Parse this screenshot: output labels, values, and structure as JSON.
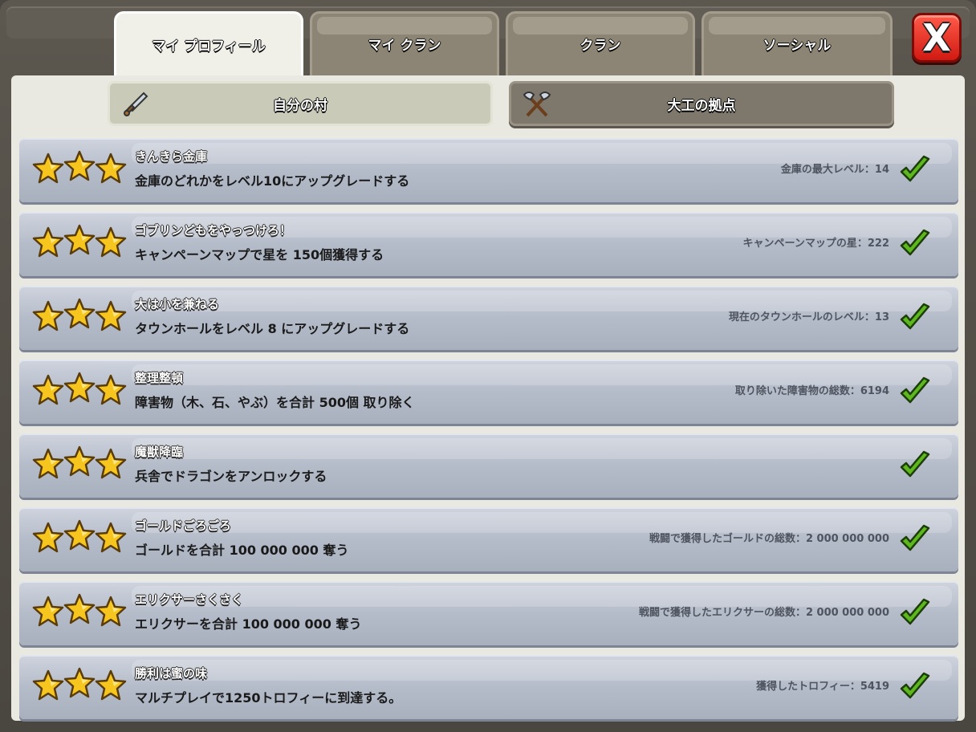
{
  "tabs": [
    {
      "label": "マイ プロフィール",
      "active": true
    },
    {
      "label": "マイ クラン",
      "active": false
    },
    {
      "label": "クラン",
      "active": false
    },
    {
      "label": "ソーシャル",
      "active": false
    }
  ],
  "close_label": "X",
  "subtabs": [
    {
      "label": "自分の村",
      "icon": "sword-icon",
      "active": true
    },
    {
      "label": "大工の拠点",
      "icon": "crossed-axes-icon",
      "active": false
    }
  ],
  "achievements": [
    {
      "title": "きんきら金庫",
      "description": "金庫のどれかをレベル10にアップグレードする",
      "status": "金庫の最大レベル：14",
      "stars": 3,
      "completed": true
    },
    {
      "title": "ゴブリンどもをやっつけろ！",
      "description": "キャンペーンマップで星を 150個獲得する",
      "status": "キャンペーンマップの星：222",
      "stars": 3,
      "completed": true
    },
    {
      "title": "大は小を兼ねる",
      "description": "タウンホールをレベル 8 にアップグレードする",
      "status": "現在のタウンホールのレベル：13",
      "stars": 3,
      "completed": true
    },
    {
      "title": "整理整頓",
      "description": "障害物（木、石、やぶ）を合計 500個 取り除く",
      "status": "取り除いた障害物の総数：6194",
      "stars": 3,
      "completed": true
    },
    {
      "title": "魔獣降臨",
      "description": "兵舎でドラゴンをアンロックする",
      "status": "",
      "stars": 3,
      "completed": true
    },
    {
      "title": "ゴールドごろごろ",
      "description": "ゴールドを合計 100 000 000 奪う",
      "status": "戦闘で獲得したゴールドの総数：2 000 000 000",
      "stars": 3,
      "completed": true
    },
    {
      "title": "エリクサーさくさく",
      "description": "エリクサーを合計 100 000 000 奪う",
      "status": "戦闘で獲得したエリクサーの総数：2 000 000 000",
      "stars": 3,
      "completed": true
    },
    {
      "title": "勝利は蜜の味",
      "description": "マルチプレイで1250トロフィーに到達する。",
      "status": "獲得したトロフィー：5419",
      "stars": 3,
      "completed": true
    }
  ],
  "colors": {
    "star_fill": "#f6c51e",
    "check_fill": "#5cb81e",
    "close_button": "#e0261b"
  }
}
